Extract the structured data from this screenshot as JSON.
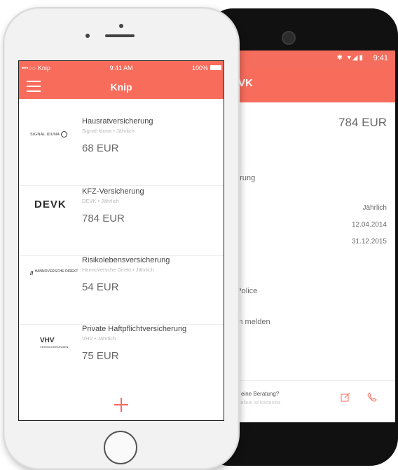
{
  "android": {
    "status": {
      "icons": "✱ ▾◢▮",
      "time": "9:41"
    },
    "title": "EVK",
    "price": "784 EUR",
    "section": "icherung",
    "faint_label": "",
    "interval": "Jährlich",
    "date_start": "12.04.2014",
    "date_end": "31.12.2015",
    "police": "he Police",
    "schaden": "aden melden",
    "bottom_question": "chst du eine Beratung?",
    "bottom_sub": "re Servicelinie ist kostenlos",
    "icons": {
      "edit": "edit-icon",
      "phone": "phone-icon"
    },
    "accent": "#f86c5c"
  },
  "iphone": {
    "status": {
      "left": "•••○○ Knip",
      "time": "9:41 AM",
      "battery": "100%"
    },
    "nav_title": "Knip",
    "policies": [
      {
        "logo": "SIGNAL IDUNA",
        "name": "Hausratversicherung",
        "sub": "Signal-Iduna • Jährlich",
        "price": "68 EUR"
      },
      {
        "logo": "DEVK",
        "name": "KFZ-Versicherung",
        "sub": "DEVK • Jährlich",
        "price": "784 EUR"
      },
      {
        "logo": "HANNOVERSCHE DIREKT",
        "name": "Risikolebensversicherung",
        "sub": "Hannoversche Direkt • Jährlich",
        "price": "54 EUR"
      },
      {
        "logo": "VHV",
        "logo_sub": "VERSICHERUNGEN",
        "name": "Private Haftpflichtversicherung",
        "sub": "VHV • Jährlich",
        "price": "75 EUR"
      }
    ]
  }
}
